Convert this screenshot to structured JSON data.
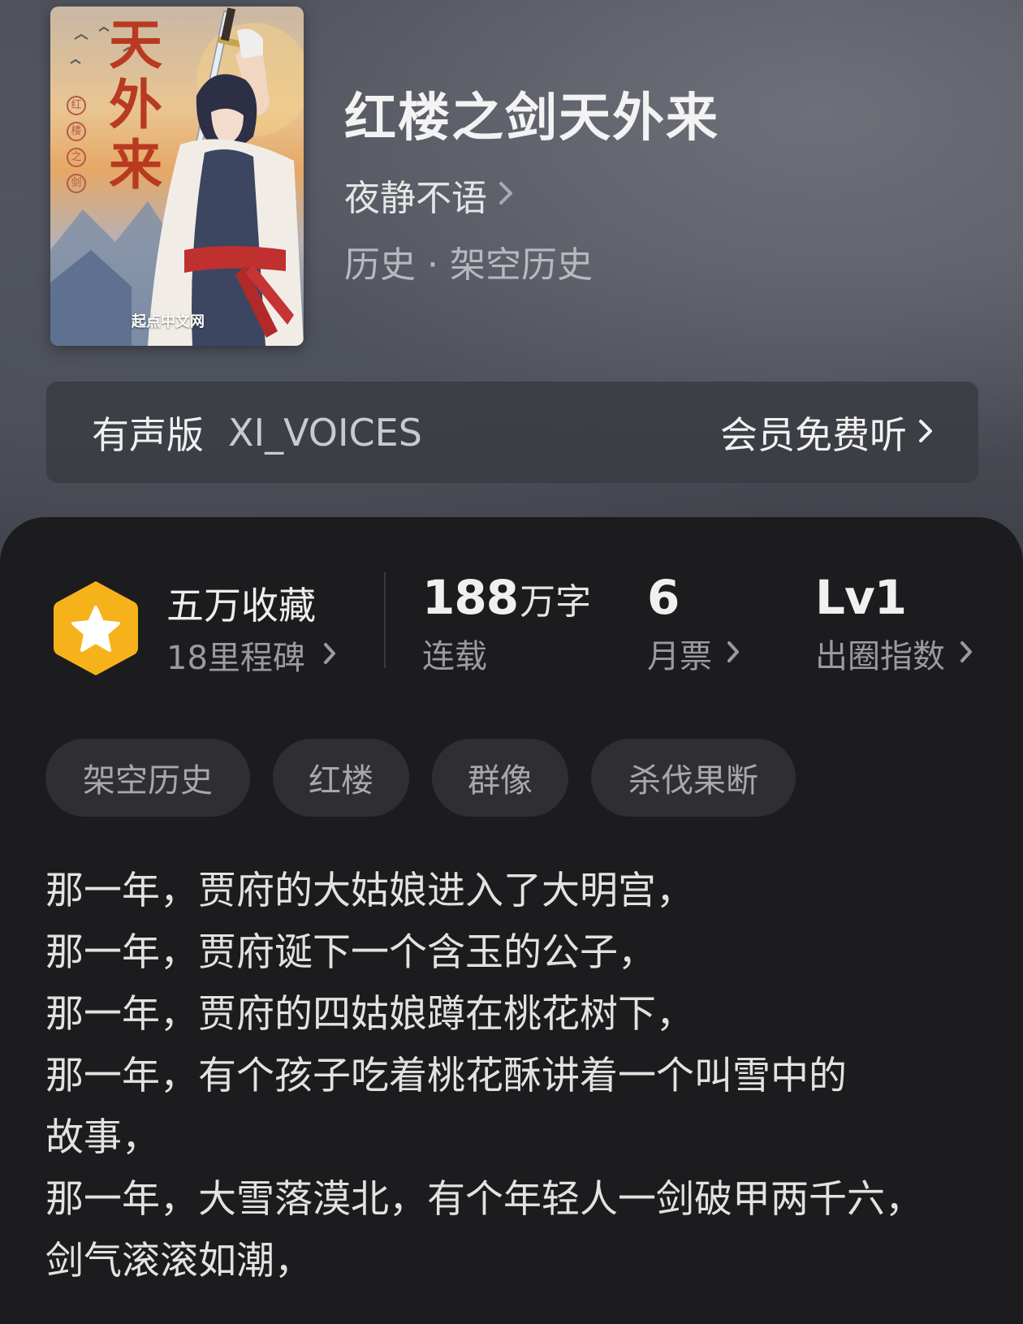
{
  "cover": {
    "title_chars": [
      "天",
      "外",
      "来"
    ],
    "sub_chars": [
      "红",
      "楼",
      "之",
      "剑"
    ],
    "brand": "起点中文网"
  },
  "book": {
    "title": "红楼之剑天外来",
    "author": "夜静不语",
    "genre": "历史 · 架空历史"
  },
  "audio": {
    "label": "有声版",
    "narrator": "XI_VOICES",
    "cta": "会员免费听"
  },
  "stats": {
    "favorites": "五万收藏",
    "milestones": "18里程碑",
    "word_count_number": "188",
    "word_count_unit": "万字",
    "status": "连载",
    "monthly_votes": "6",
    "monthly_votes_label": "月票",
    "level": "Lv1",
    "level_label": "出圈指数"
  },
  "tags": [
    "架空历史",
    "红楼",
    "群像",
    "杀伐果断"
  ],
  "description": [
    "那一年，贾府的大姑娘进入了大明宫，",
    "那一年，贾府诞下一个含玉的公子，",
    "那一年，贾府的四姑娘蹲在桃花树下，",
    "那一年，有个孩子吃着桃花酥讲着一个叫雪中的",
    "故事，",
    "那一年，大雪落漠北，有个年轻人一剑破甲两千六，",
    "剑气滚滚如潮，"
  ],
  "colors": {
    "badge_fill": "#f6b21a",
    "panel_bg": "#1c1c1e",
    "tag_bg": "#2f2f32"
  },
  "icons": [
    "star-badge-icon",
    "chevron-right-icon"
  ]
}
